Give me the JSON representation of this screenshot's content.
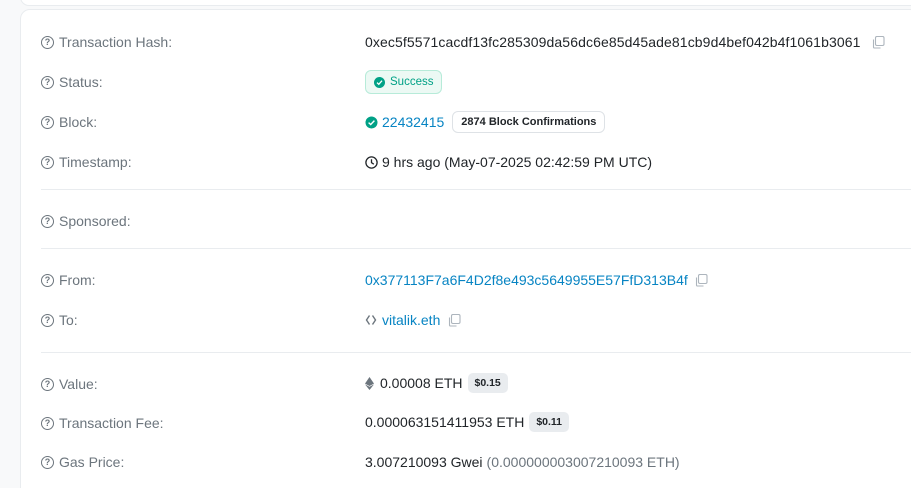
{
  "rows": {
    "tx_hash": {
      "label": "Transaction Hash:",
      "value": "0xec5f5571cacdf13fc285309da56dc6e85d45ade81cb9d4bef042b4f1061b3061"
    },
    "status": {
      "label": "Status:",
      "value": "Success"
    },
    "block": {
      "label": "Block:",
      "value": "22432415",
      "confirmations": "2874 Block Confirmations"
    },
    "timestamp": {
      "label": "Timestamp:",
      "value": "9 hrs ago (May-07-2025 02:42:59 PM UTC)"
    },
    "sponsored": {
      "label": "Sponsored:"
    },
    "from": {
      "label": "From:",
      "value": "0x377113F7a6F4D2f8e493c5649955E57FfD313B4f"
    },
    "to": {
      "label": "To:",
      "value": "vitalik.eth"
    },
    "value": {
      "label": "Value:",
      "value": "0.00008 ETH",
      "usd": "$0.15"
    },
    "fee": {
      "label": "Transaction Fee:",
      "value": "0.000063151411953 ETH",
      "usd": "$0.11"
    },
    "gas_price": {
      "label": "Gas Price:",
      "value": "3.007210093 Gwei",
      "eth_equiv": "(0.000000003007210093 ETH)"
    }
  },
  "colors": {
    "link": "#0784c3",
    "success": "#00a186",
    "muted": "#6c757d"
  },
  "icons": {
    "help": "question-circle-icon",
    "copy": "copy-icon",
    "status_check": "check-circle-icon",
    "block_check": "check-circle-outline-icon",
    "clock": "clock-icon",
    "eth": "ethereum-icon",
    "ens": "ens-icon"
  }
}
